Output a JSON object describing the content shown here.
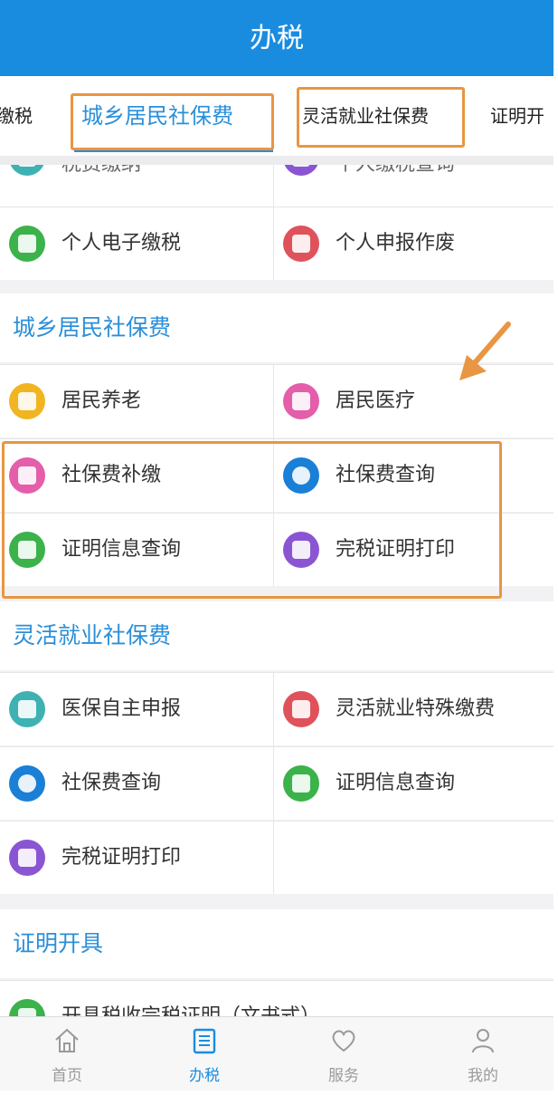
{
  "header": {
    "title": "办税"
  },
  "tabs": [
    {
      "label": "缴税"
    },
    {
      "label": "城乡居民社保费"
    },
    {
      "label": "灵活就业社保费"
    },
    {
      "label": "证明开"
    }
  ],
  "partial_rows": {
    "left": "税费缴纳",
    "right": "个人缴税查询"
  },
  "tax_items": [
    {
      "label": "个人电子缴税",
      "icon": "person-icon",
      "color": "#3bb24a"
    },
    {
      "label": "个人申报作废",
      "icon": "document-void-icon",
      "color": "#e0525b"
    }
  ],
  "section1": {
    "title": "城乡居民社保费",
    "items": [
      {
        "label": "居民养老",
        "icon": "elder-icon",
        "color": "#f0b521"
      },
      {
        "label": "居民医疗",
        "icon": "medical-icon",
        "color": "#e45ea9"
      },
      {
        "label": "社保费补缴",
        "icon": "heart-badge-icon",
        "color": "#e45ea9"
      },
      {
        "label": "社保费查询",
        "icon": "search-circle-icon",
        "color": "#1a7fd6"
      },
      {
        "label": "证明信息查询",
        "icon": "pen-icon",
        "color": "#3bb24a"
      },
      {
        "label": "完税证明打印",
        "icon": "print-icon",
        "color": "#8a55d3"
      }
    ]
  },
  "section2": {
    "title": "灵活就业社保费",
    "items": [
      {
        "label": "医保自主申报",
        "icon": "monitor-icon",
        "color": "#3eb1b3"
      },
      {
        "label": "灵活就业特殊缴费",
        "icon": "card-icon",
        "color": "#e0525b"
      },
      {
        "label": "社保费查询",
        "icon": "search-circle-icon",
        "color": "#1a7fd6"
      },
      {
        "label": "证明信息查询",
        "icon": "pen-icon",
        "color": "#3bb24a"
      },
      {
        "label": "完税证明打印",
        "icon": "print-icon",
        "color": "#8a55d3"
      }
    ]
  },
  "section3": {
    "title": "证明开具",
    "partial_item": "开具税收完税证明（文书式）"
  },
  "bottom_nav": [
    {
      "label": "首页",
      "icon": "home-icon"
    },
    {
      "label": "办税",
      "icon": "list-icon"
    },
    {
      "label": "服务",
      "icon": "heart-icon"
    },
    {
      "label": "我的",
      "icon": "user-icon"
    }
  ],
  "colors": {
    "brand": "#1a8ce0",
    "highlight": "#e89643"
  }
}
